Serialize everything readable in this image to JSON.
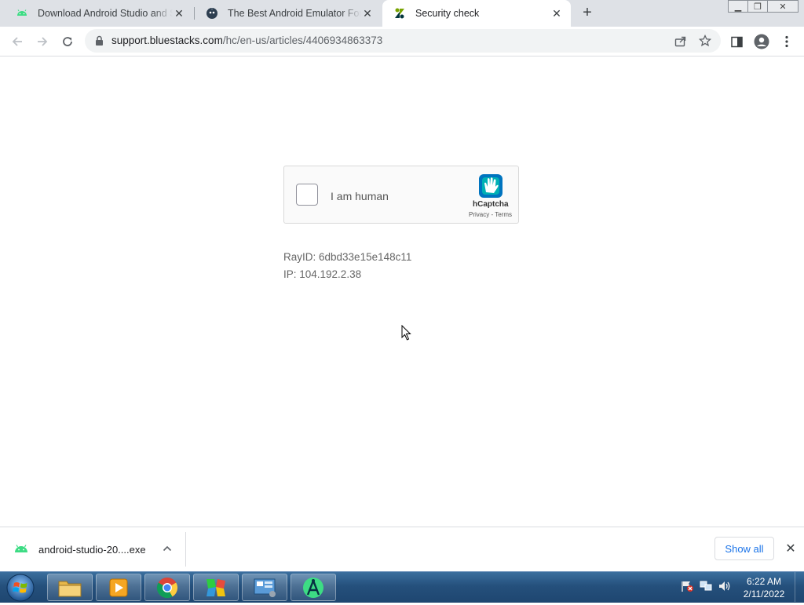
{
  "browser": {
    "tabs": [
      {
        "title": "Download Android Studio and SDK tools | Android Developers",
        "icon": "android-icon",
        "active": false
      },
      {
        "title": "The Best Android Emulator For PC",
        "icon": "bluestacks-icon",
        "active": false
      },
      {
        "title": "Security check",
        "icon": "zendesk-icon",
        "active": true
      }
    ],
    "new_tab_label": "+",
    "window_controls": {
      "minimize": "▁",
      "restore": "❐",
      "close": "✕"
    },
    "url_host": "support.bluestacks.com",
    "url_path": "/hc/en-us/articles/4406934863373"
  },
  "captcha": {
    "checkbox_label": "I am human",
    "brand": "hCaptcha",
    "privacy": "Privacy",
    "separator": " - ",
    "terms": "Terms",
    "checked": false
  },
  "meta": {
    "ray_id": "RayID: 6dbd33e15e148c11",
    "ip": "IP: 104.192.2.38"
  },
  "download": {
    "filename": "android-studio-20....exe",
    "show_all_label": "Show all"
  },
  "taskbar": {
    "apps": [
      "explorer-icon",
      "media-player-icon",
      "chrome-icon",
      "bluestacks-icon",
      "control-panel-icon",
      "android-studio-icon"
    ],
    "time": "6:22 AM",
    "date": "2/11/2022"
  }
}
